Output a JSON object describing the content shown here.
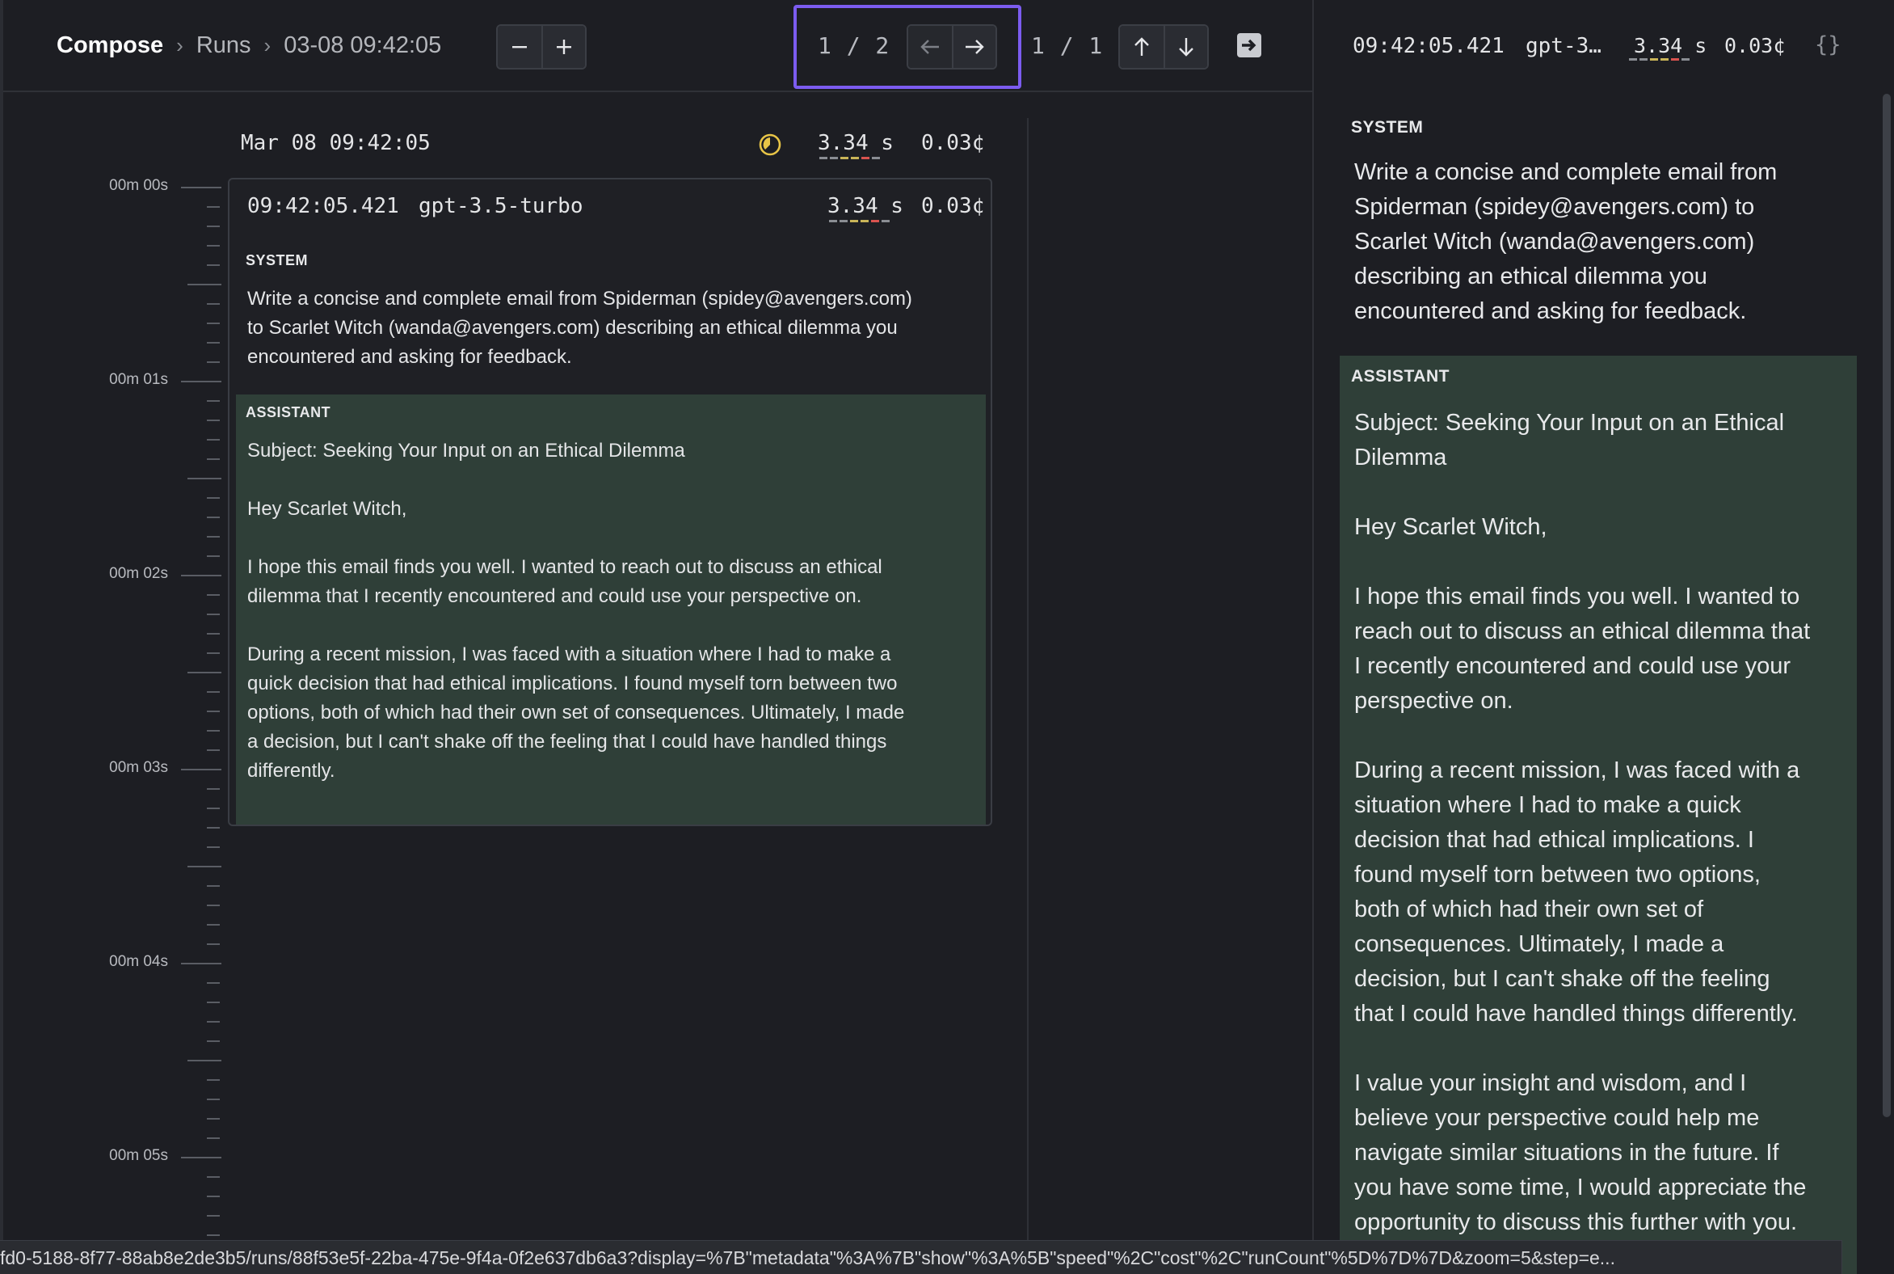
{
  "breadcrumb": {
    "root": "Compose",
    "items": [
      "Runs",
      "03-08 09:42:05"
    ]
  },
  "toolbar": {
    "run_counter": "1 / 2",
    "step_counter": "1 / 1"
  },
  "timeline": {
    "labels": [
      "00m 00s",
      "00m 01s",
      "00m 02s",
      "00m 03s",
      "00m 04s",
      "00m 05s"
    ]
  },
  "run": {
    "date": "Mar 08 09:42:05",
    "duration": "3.34 s",
    "cost": "0.03¢"
  },
  "card": {
    "time": "09:42:05.421",
    "model": "gpt-3.5-turbo",
    "duration": "3.34 s",
    "cost": "0.03¢",
    "system_label": "SYSTEM",
    "system_text": "Write a concise and complete email from Spiderman (spidey@avengers.com)\nto Scarlet Witch (wanda@avengers.com) describing an ethical dilemma you\nencountered and asking for feedback.",
    "assistant_label": "ASSISTANT",
    "assistant_text": "Subject: Seeking Your Input on an Ethical Dilemma\n\nHey Scarlet Witch,\n\nI hope this email finds you well. I wanted to reach out to discuss an ethical\ndilemma that I recently encountered and could use your perspective on.\n\nDuring a recent mission, I was faced with a situation where I had to make a\nquick decision that had ethical implications. I found myself torn between two\noptions, both of which had their own set of consequences. Ultimately, I made\na decision, but I can't shake off the feeling that I could have handled things\ndifferently."
  },
  "detail": {
    "time": "09:42:05.421",
    "model": "gpt-3…",
    "duration": "3.34 s",
    "cost": "0.03¢",
    "json_icon": "{}",
    "system_label": "SYSTEM",
    "system_text": "Write a concise and complete email from\nSpiderman (spidey@avengers.com) to\nScarlet Witch (wanda@avengers.com)\ndescribing an ethical dilemma you\nencountered and asking for feedback.",
    "assistant_label": "ASSISTANT",
    "assistant_text": "Subject: Seeking Your Input on an Ethical\nDilemma\n\nHey Scarlet Witch,\n\nI hope this email finds you well. I wanted to\nreach out to discuss an ethical dilemma that\nI recently encountered and could use your\nperspective on.\n\nDuring a recent mission, I was faced with a\nsituation where I had to make a quick\ndecision that had ethical implications. I\nfound myself torn between two options,\nboth of which had their own set of\nconsequences. Ultimately, I made a\ndecision, but I can't shake off the feeling\nthat I could have handled things differently.\n\nI value your insight and wisdom, and I\nbelieve your perspective could help me\nnavigate similar situations in the future. If\nyou have some time, I would appreciate the\nopportunity to discuss this further with you."
  },
  "status_url": "fd0-5188-8f77-88ab8e2de3b5/runs/88f53e5f-22ba-475e-9f4a-0f2e637db6a3?display=%7B\"metadata\"%3A%7B\"show\"%3A%5B\"speed\"%2C\"cost\"%2C\"runCount\"%5D%7D%7D&zoom=5&step=e...",
  "colors": {
    "accent_focus": "#7c5cf0",
    "assistant_bg": "#2f3f38",
    "speed_segments": [
      "#8a8d93",
      "#8a8d93",
      "#c9b458",
      "#c9b458",
      "#d9534f",
      "#8a8d93"
    ]
  }
}
